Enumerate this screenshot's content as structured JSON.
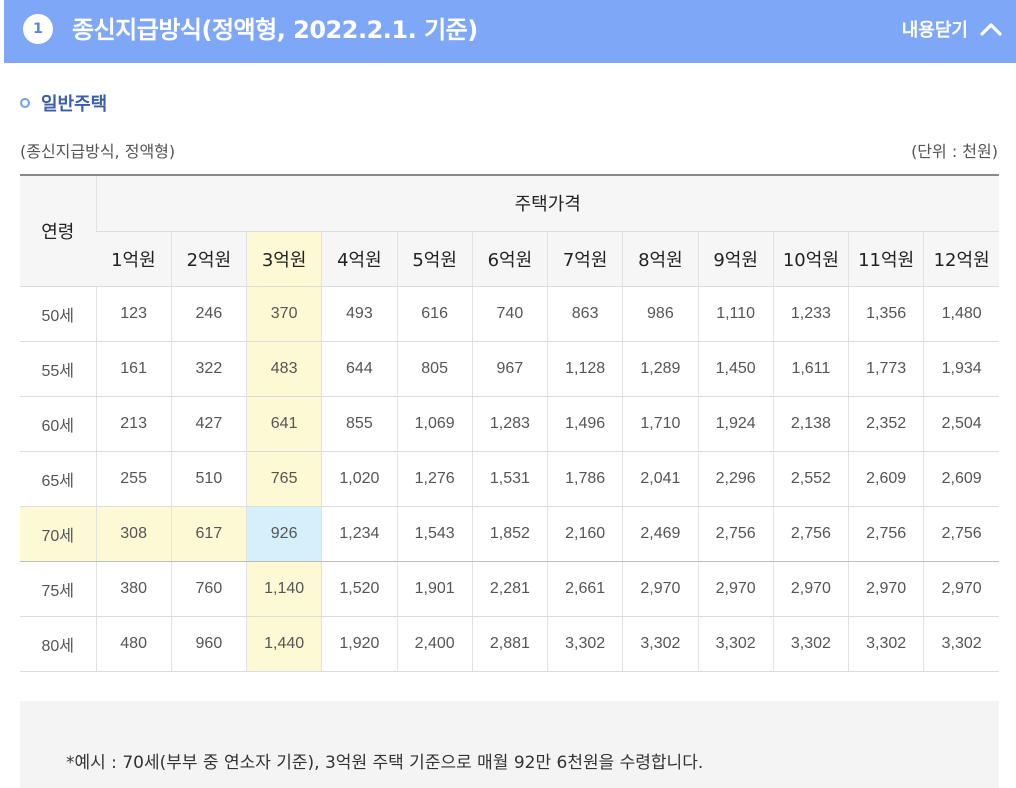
{
  "header": {
    "number": "1",
    "title": "종신지급방식(정액형, 2022.2.1. 기준)",
    "toggle_label": "내용닫기",
    "accent_color": "#7fa7f8"
  },
  "section": {
    "title": "일반주택",
    "subtitle": "(종신지급방식, 정액형)",
    "unit": "(단위 : 천원)"
  },
  "table": {
    "age_header": "연령",
    "price_header": "주택가격",
    "price_cols": [
      "1억원",
      "2억원",
      "3억원",
      "4억원",
      "5억원",
      "6억원",
      "7억원",
      "8억원",
      "9억원",
      "10억원",
      "11억원",
      "12억원"
    ],
    "rows": [
      {
        "age": "50세",
        "values": [
          "123",
          "246",
          "370",
          "493",
          "616",
          "740",
          "863",
          "986",
          "1,110",
          "1,233",
          "1,356",
          "1,480"
        ]
      },
      {
        "age": "55세",
        "values": [
          "161",
          "322",
          "483",
          "644",
          "805",
          "967",
          "1,128",
          "1,289",
          "1,450",
          "1,611",
          "1,773",
          "1,934"
        ]
      },
      {
        "age": "60세",
        "values": [
          "213",
          "427",
          "641",
          "855",
          "1,069",
          "1,283",
          "1,496",
          "1,710",
          "1,924",
          "2,138",
          "2,352",
          "2,504"
        ]
      },
      {
        "age": "65세",
        "values": [
          "255",
          "510",
          "765",
          "1,020",
          "1,276",
          "1,531",
          "1,786",
          "2,041",
          "2,296",
          "2,552",
          "2,609",
          "2,609"
        ]
      },
      {
        "age": "70세",
        "values": [
          "308",
          "617",
          "926",
          "1,234",
          "1,543",
          "1,852",
          "2,160",
          "2,469",
          "2,756",
          "2,756",
          "2,756",
          "2,756"
        ]
      },
      {
        "age": "75세",
        "values": [
          "380",
          "760",
          "1,140",
          "1,520",
          "1,901",
          "2,281",
          "2,661",
          "2,970",
          "2,970",
          "2,970",
          "2,970",
          "2,970"
        ]
      },
      {
        "age": "80세",
        "values": [
          "480",
          "960",
          "1,440",
          "1,920",
          "2,400",
          "2,881",
          "3,302",
          "3,302",
          "3,302",
          "3,302",
          "3,302",
          "3,302"
        ]
      }
    ],
    "highlight_col_color": "#fdf9d4",
    "highlight_cell_color": "#d5f0fb"
  },
  "note": "*예시 : 70세(부부 중 연소자 기준), 3억원 주택 기준으로 매월 92만 6천원을 수령합니다."
}
